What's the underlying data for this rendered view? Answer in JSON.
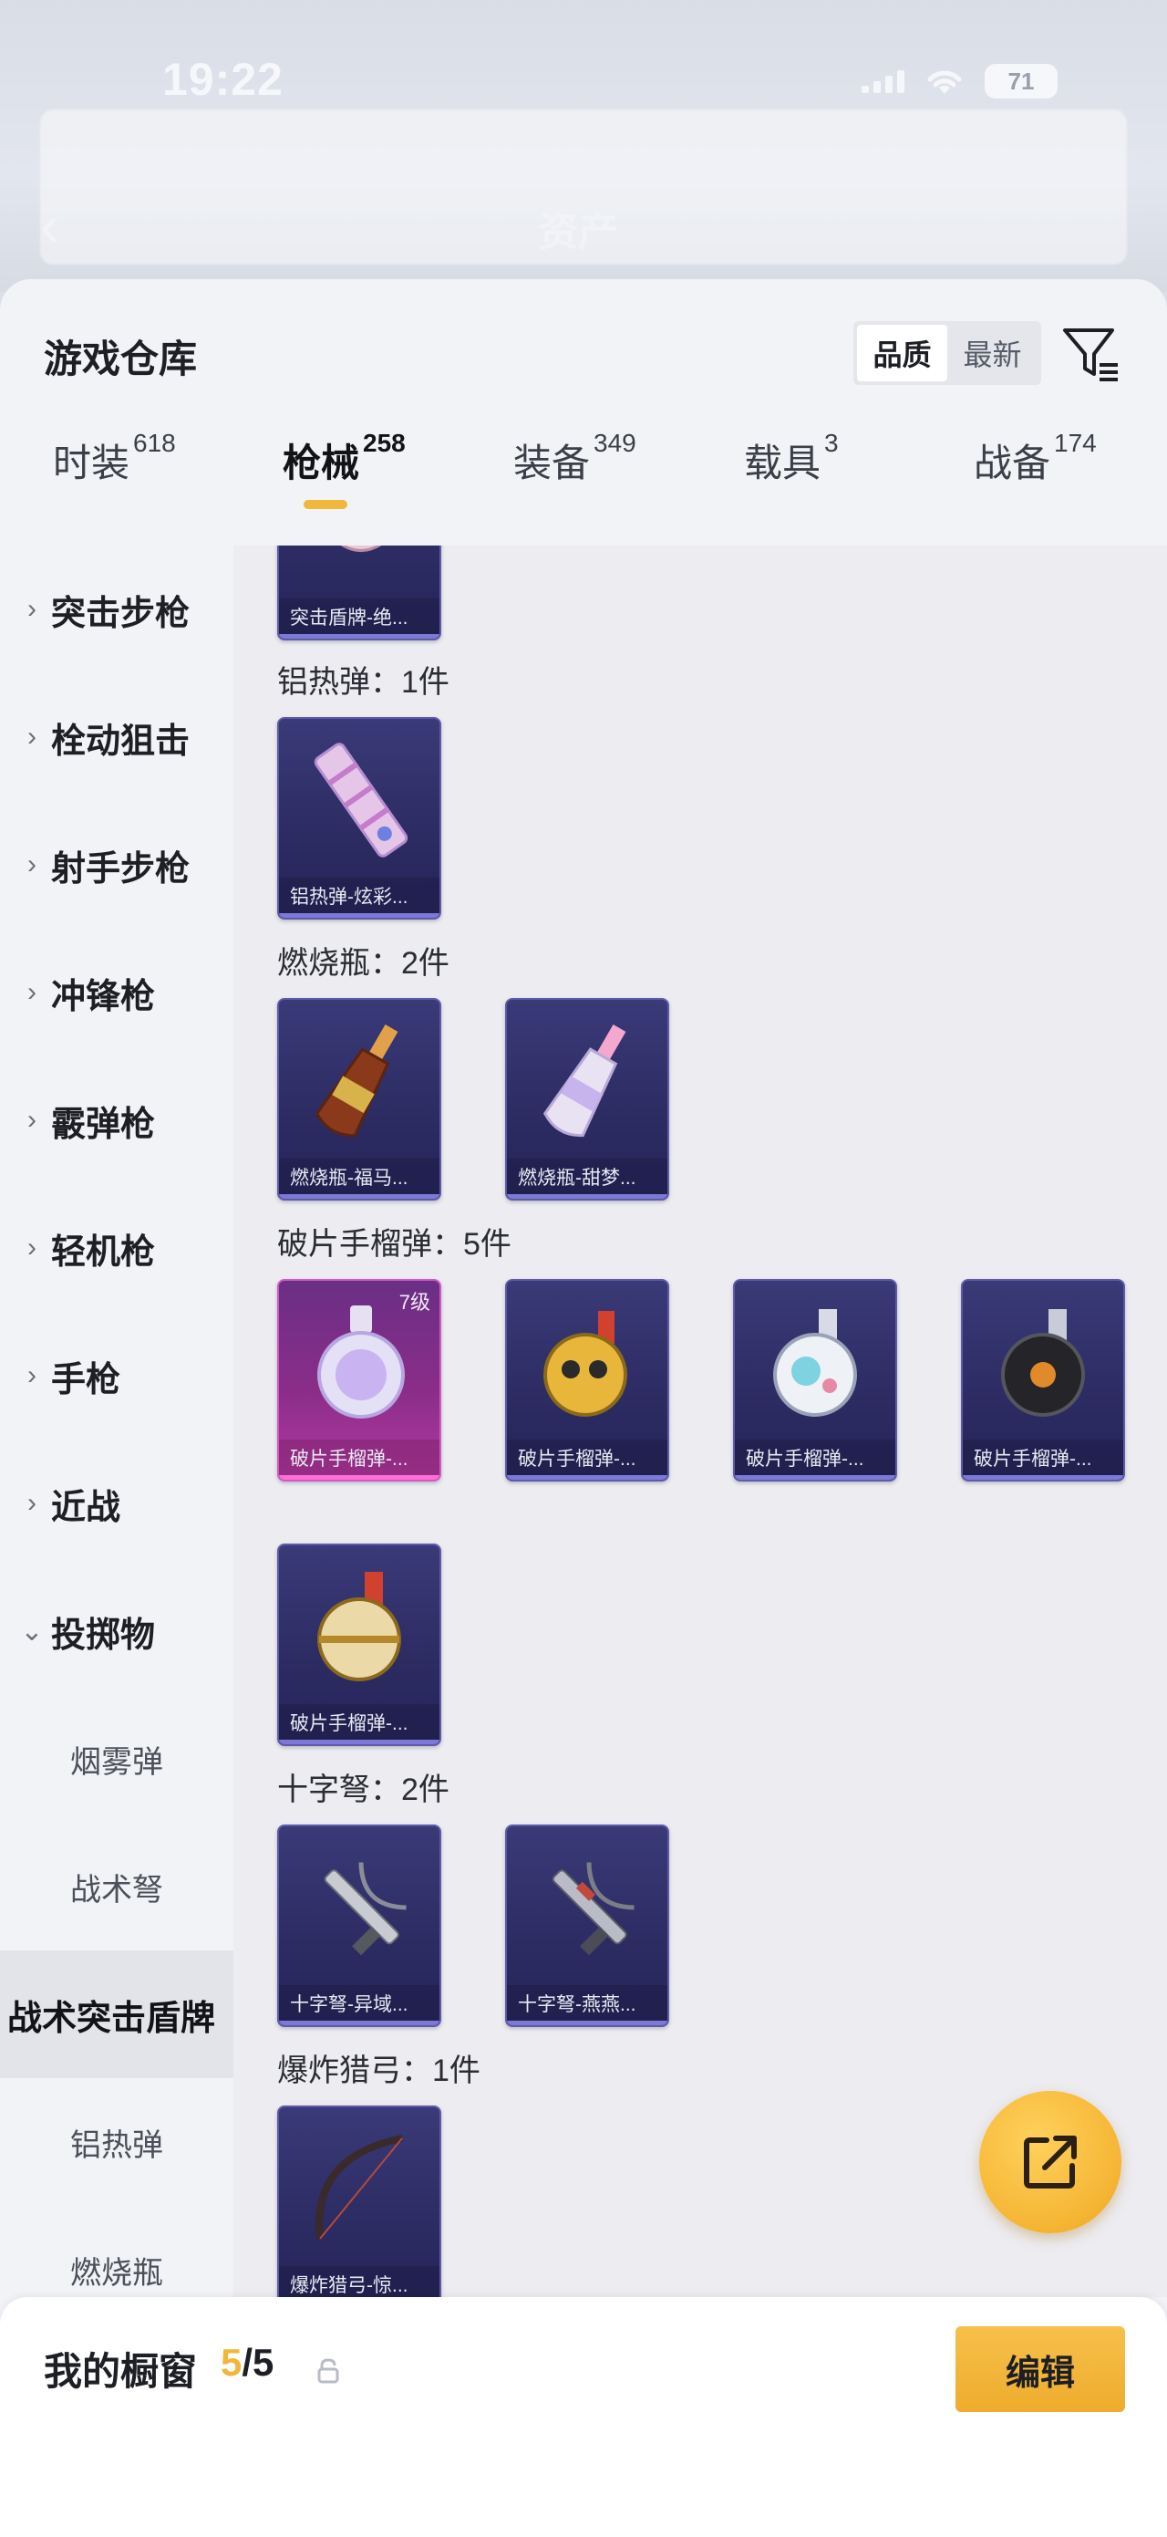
{
  "status_bar": {
    "time": "19:22",
    "battery": "71"
  },
  "background": {
    "back_glyph": "‹",
    "title": "资产"
  },
  "warehouse": {
    "title": "游戏仓库",
    "sort": {
      "options": [
        "品质",
        "最新"
      ],
      "active": "品质"
    },
    "filter_icon": "filter-icon"
  },
  "tabs": [
    {
      "label": "时装",
      "count": "618",
      "active": false
    },
    {
      "label": "枪械",
      "count": "258",
      "active": true
    },
    {
      "label": "装备",
      "count": "349",
      "active": false
    },
    {
      "label": "载具",
      "count": "3",
      "active": false
    },
    {
      "label": "战备",
      "count": "174",
      "active": false
    }
  ],
  "sidebar": {
    "categories": [
      {
        "label": "突击步枪",
        "chevron": "›"
      },
      {
        "label": "栓动狙击",
        "chevron": "›"
      },
      {
        "label": "射手步枪",
        "chevron": "›"
      },
      {
        "label": "冲锋枪",
        "chevron": "›"
      },
      {
        "label": "霰弹枪",
        "chevron": "›"
      },
      {
        "label": "轻机枪",
        "chevron": "›"
      },
      {
        "label": "手枪",
        "chevron": "›"
      },
      {
        "label": "近战",
        "chevron": "›"
      },
      {
        "label": "投掷物",
        "chevron": "⌄"
      }
    ],
    "subcategories": [
      {
        "label": "烟雾弹",
        "active": false
      },
      {
        "label": "战术弩",
        "active": false
      },
      {
        "label": "战术突击盾牌",
        "active": true
      },
      {
        "label": "铝热弹",
        "active": false
      },
      {
        "label": "燃烧瓶",
        "active": false
      }
    ]
  },
  "content": {
    "partial_card_caption": "突击盾牌-绝...",
    "groups": [
      {
        "title": "铝热弹：1件",
        "items": [
          {
            "caption": "铝热弹-炫彩...",
            "icon": "thermite-icon"
          }
        ]
      },
      {
        "title": "燃烧瓶：2件",
        "items": [
          {
            "caption": "燃烧瓶-福马...",
            "icon": "molotov-icon"
          },
          {
            "caption": "燃烧瓶-甜梦...",
            "icon": "molotov-icon"
          }
        ]
      },
      {
        "title": "破片手榴弹：5件",
        "items": [
          {
            "caption": "破片手榴弹-...",
            "icon": "grenade-icon",
            "level": "7级",
            "rarity": "pink"
          },
          {
            "caption": "破片手榴弹-...",
            "icon": "grenade-icon"
          },
          {
            "caption": "破片手榴弹-...",
            "icon": "grenade-icon"
          },
          {
            "caption": "破片手榴弹-...",
            "icon": "grenade-icon"
          },
          {
            "caption": "破片手榴弹-...",
            "icon": "grenade-icon"
          }
        ]
      },
      {
        "title": "十字弩：2件",
        "items": [
          {
            "caption": "十字弩-异域...",
            "icon": "crossbow-icon"
          },
          {
            "caption": "十字弩-燕燕...",
            "icon": "crossbow-icon"
          }
        ]
      },
      {
        "title": "爆炸猎弓：1件",
        "items": [
          {
            "caption": "爆炸猎弓-惊...",
            "icon": "bow-icon"
          }
        ]
      }
    ]
  },
  "fab": {
    "icon": "share-external-icon"
  },
  "showcase": {
    "title": "我的橱窗",
    "current": "5",
    "slash": "/",
    "max": "5",
    "edit_label": "编辑",
    "accent_color": "#f0b73a"
  }
}
